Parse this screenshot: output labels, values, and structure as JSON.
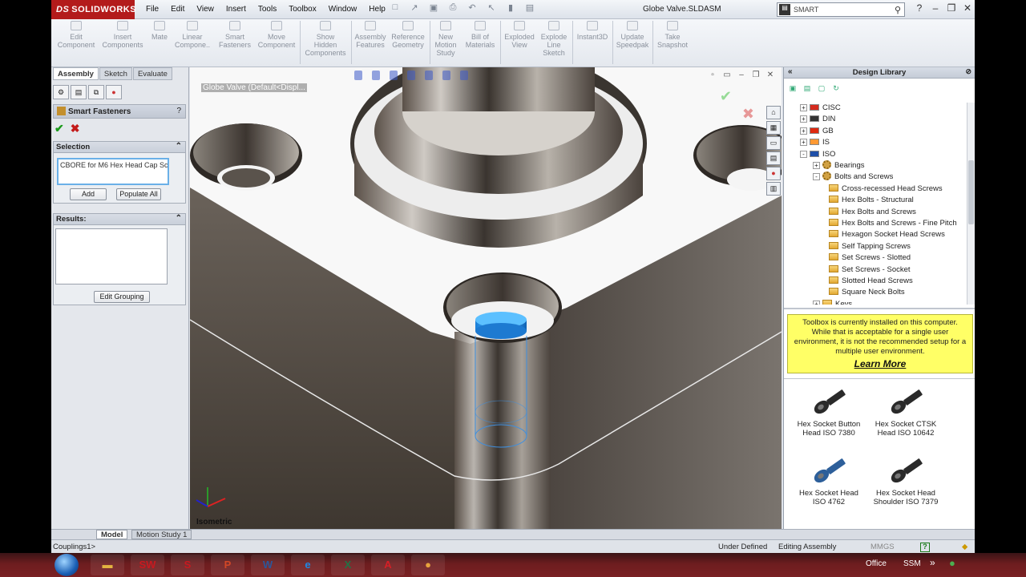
{
  "app": {
    "brand": "SOLIDWORKS",
    "brand_prefix": "DS",
    "menus": [
      "File",
      "Edit",
      "View",
      "Insert",
      "Tools",
      "Toolbox",
      "Window",
      "Help"
    ],
    "doc_title": "Globe Valve.SLDASM",
    "search_placeholder": "SMART"
  },
  "command_manager": {
    "buttons": [
      {
        "label": "Edit\nComponent"
      },
      {
        "label": "Insert\nComponents"
      },
      {
        "label": "Mate"
      },
      {
        "label": "Linear\nCompone.."
      },
      {
        "label": "Smart\nFasteners"
      },
      {
        "label": "Move\nComponent"
      },
      {
        "label": "Show\nHidden\nComponents"
      },
      {
        "label": "Assembly\nFeatures"
      },
      {
        "label": "Reference\nGeometry"
      },
      {
        "label": "New\nMotion\nStudy"
      },
      {
        "label": "Bill of\nMaterials"
      },
      {
        "label": "Exploded\nView"
      },
      {
        "label": "Explode\nLine\nSketch"
      },
      {
        "label": "Instant3D"
      },
      {
        "label": "Update\nSpeedpak"
      },
      {
        "label": "Take\nSnapshot"
      }
    ]
  },
  "left_panel": {
    "tabs": [
      "Assembly",
      "Sketch",
      "Evaluate"
    ],
    "property_title": "Smart Fasteners",
    "help_glyph": "?",
    "selection_label": "Selection",
    "selection_value": "CBORE for M6 Hex Head Cap Scr",
    "add_label": "Add",
    "populate_label": "Populate All",
    "results_label": "Results:",
    "edit_grouping_label": "Edit Grouping"
  },
  "viewport": {
    "tree_path": "Globe Valve  (Default<Displ...",
    "view_label": "Isometric"
  },
  "design_library": {
    "title": "Design Library",
    "tree": [
      {
        "label": "CISC",
        "level": 1,
        "kind": "flag",
        "flag": "#d52b1e",
        "exp": "+"
      },
      {
        "label": "DIN",
        "level": 1,
        "kind": "flag",
        "flag": "#333333",
        "exp": "+"
      },
      {
        "label": "GB",
        "level": 1,
        "kind": "flag",
        "flag": "#de2910",
        "exp": "+"
      },
      {
        "label": "IS",
        "level": 1,
        "kind": "flag",
        "flag": "#ff9933",
        "exp": "+"
      },
      {
        "label": "ISO",
        "level": 1,
        "kind": "flag",
        "flag": "#1f4fa8",
        "exp": "-"
      },
      {
        "label": "Bearings",
        "level": 2,
        "kind": "gear",
        "exp": "+"
      },
      {
        "label": "Bolts and Screws",
        "level": 2,
        "kind": "gear",
        "exp": "-"
      },
      {
        "label": "Cross-recessed Head Screws",
        "level": 3,
        "kind": "folder"
      },
      {
        "label": "Hex Bolts - Structural",
        "level": 3,
        "kind": "folder"
      },
      {
        "label": "Hex Bolts and Screws",
        "level": 3,
        "kind": "folder"
      },
      {
        "label": "Hex Bolts and Screws - Fine Pitch",
        "level": 3,
        "kind": "folder"
      },
      {
        "label": "Hexagon Socket Head Screws",
        "level": 3,
        "kind": "folder"
      },
      {
        "label": "Self Tapping Screws",
        "level": 3,
        "kind": "folder"
      },
      {
        "label": "Set Screws - Slotted",
        "level": 3,
        "kind": "folder"
      },
      {
        "label": "Set Screws - Socket",
        "level": 3,
        "kind": "folder"
      },
      {
        "label": "Slotted Head Screws",
        "level": 3,
        "kind": "folder"
      },
      {
        "label": "Square Neck Bolts",
        "level": 3,
        "kind": "folder"
      },
      {
        "label": "Keys",
        "level": 2,
        "kind": "folder",
        "exp": "+"
      }
    ],
    "notice": "Toolbox is currently installed on this computer. While that is acceptable for a single user environment, it is not the recommended setup for a multiple user environment.",
    "learn_more": "Learn More",
    "parts": [
      {
        "line1": "Hex Socket Button",
        "line2": "Head ISO 7380",
        "color": "#2a2a2a"
      },
      {
        "line1": "Hex Socket CTSK",
        "line2": "Head ISO 10642",
        "color": "#2a2a2a"
      },
      {
        "line1": "Hex Socket Head",
        "line2": "ISO 4762",
        "color": "#2d5f9a"
      },
      {
        "line1": "Hex Socket Head",
        "line2": "Shoulder ISO 7379",
        "color": "#2a2a2a"
      }
    ]
  },
  "bottom_tabs": [
    "Model",
    "Motion Study 1"
  ],
  "status": {
    "left": "Couplings1>",
    "under_defined": "Under Defined",
    "mode": "Editing Assembly",
    "units": "MMGS",
    "help": "?"
  },
  "taskbar": {
    "apps": [
      {
        "name": "explorer",
        "glyph": "▬",
        "color": "#e3b341"
      },
      {
        "name": "solidworks",
        "glyph": "SW",
        "color": "#c8191f"
      },
      {
        "name": "solidworks-explorer",
        "glyph": "S",
        "color": "#c8191f"
      },
      {
        "name": "powerpoint",
        "glyph": "P",
        "color": "#d24726"
      },
      {
        "name": "word",
        "glyph": "W",
        "color": "#2b579a"
      },
      {
        "name": "internet-explorer",
        "glyph": "e",
        "color": "#1e88e5"
      },
      {
        "name": "excel",
        "glyph": "X",
        "color": "#217346"
      },
      {
        "name": "acrobat",
        "glyph": "A",
        "color": "#d71f26"
      },
      {
        "name": "chrome",
        "glyph": "●",
        "color": "#e8a33d"
      }
    ],
    "tray_office": "Office",
    "tray_ssm": "SSM"
  }
}
